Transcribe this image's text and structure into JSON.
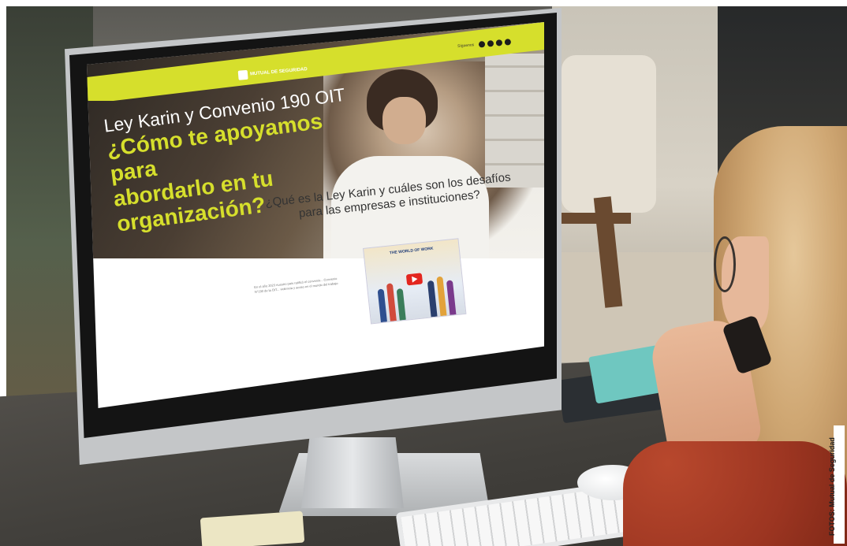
{
  "website": {
    "logo_text": "MUTUAL DE SEGURIDAD",
    "social_label": "Síguenos",
    "social_icons": [
      "facebook-icon",
      "instagram-icon",
      "linkedin-icon",
      "youtube-icon"
    ],
    "hero": {
      "line1": "Ley Karin  y Convenio 190 OIT",
      "line2": "¿Cómo te apoyamos para",
      "line3": "abordarlo en tu organización?"
    },
    "section": {
      "title": "¿Qué es la Ley Karin y cuáles son los desafíos para las empresas e instituciones?",
      "body": "En el año 2023 nuestro país ratificó el convenio... Convenio N°190 de la OIT... violencia y acoso en el mundo del trabajo",
      "video_title": "THE WORLD OF WORK"
    }
  },
  "photo_credit": "FOTOS: Mutual de Seguridad",
  "colors": {
    "accent": "#d6df2c",
    "hero_text": "#ffffff",
    "video_play": "#e3261f"
  }
}
